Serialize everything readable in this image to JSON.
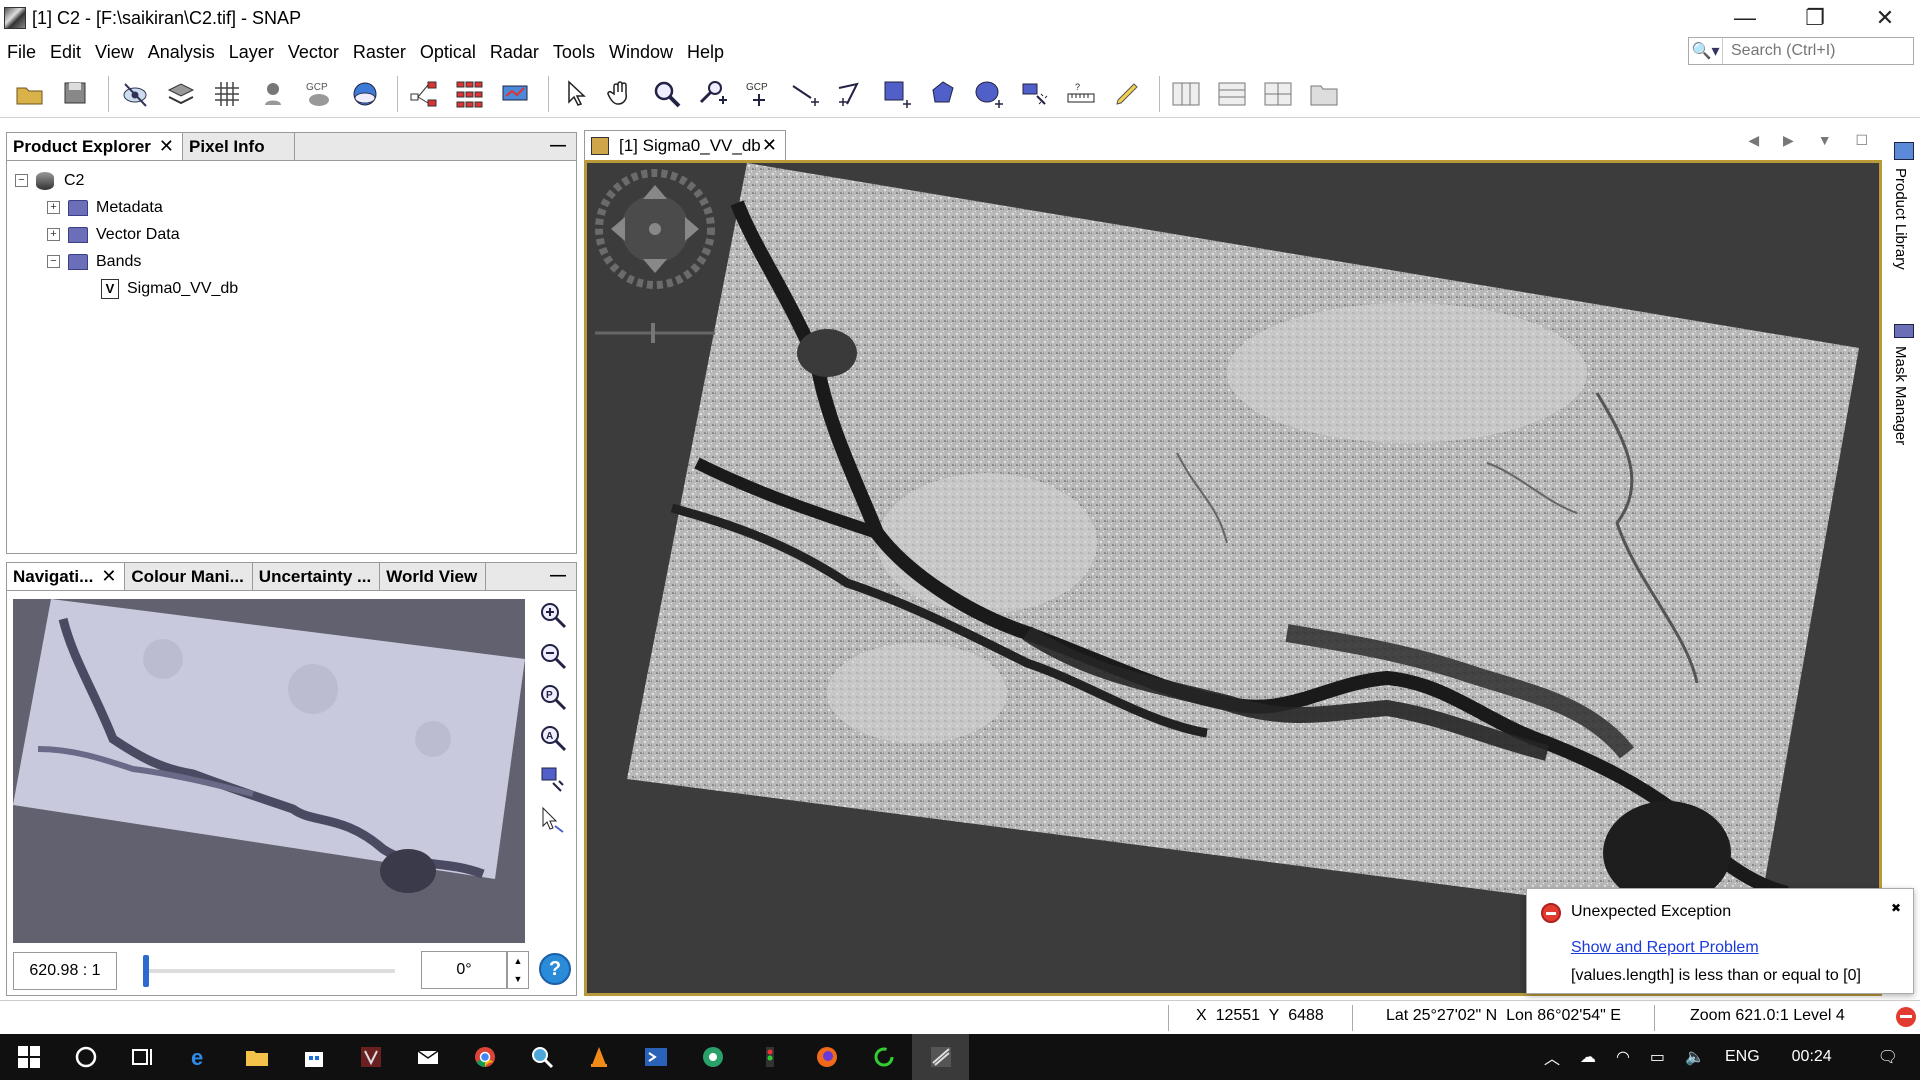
{
  "window": {
    "title": "[1] C2 - [F:\\saikiran\\C2.tif] - SNAP",
    "minimize": "—",
    "restore": "❐",
    "close": "✕"
  },
  "menu": [
    "File",
    "Edit",
    "View",
    "Analysis",
    "Layer",
    "Vector",
    "Raster",
    "Optical",
    "Radar",
    "Tools",
    "Window",
    "Help"
  ],
  "search": {
    "placeholder": "Search (Ctrl+I)"
  },
  "product_explorer": {
    "tabs": [
      {
        "label": "Product Explorer",
        "close": "✕"
      },
      {
        "label": "Pixel Info"
      }
    ],
    "minimize": "—",
    "tree": {
      "root": "C2",
      "expand_plus": "+",
      "expand_minus": "−",
      "children": [
        "Metadata",
        "Vector Data",
        "Bands"
      ],
      "band_icon": "V",
      "band": "Sigma0_VV_db"
    }
  },
  "navigation": {
    "tabs": [
      {
        "label": "Navigati...",
        "close": "✕"
      },
      {
        "label": "Colour Mani..."
      },
      {
        "label": "Uncertainty ..."
      },
      {
        "label": "World View"
      }
    ],
    "minimize": "—",
    "scale": "620.98 : 1",
    "rotation": "0°",
    "spin_up": "▲",
    "spin_down": "▼",
    "help": "?",
    "zoom_slider_value": 0.0
  },
  "image_view": {
    "tab_label": "[1] Sigma0_VV_db",
    "tab_close": "✕",
    "controls": "◀ ▶ ▼ ☐"
  },
  "right_sidebar": {
    "product_library": "Product Library",
    "mask_manager": "Mask Manager"
  },
  "notification": {
    "title": "Unexpected Exception",
    "link": "Show and Report Problem",
    "message": "[values.length] is less than or equal to [0]",
    "close": "✖"
  },
  "status": {
    "x_label": "X",
    "x": "12551",
    "y_label": "Y",
    "y": "6488",
    "lat_label": "Lat",
    "lat": "25°27'02\" N",
    "lon_label": "Lon",
    "lon": "86°02'54\" E",
    "zoom": "Zoom 621.0:1",
    "level": "Level 4"
  },
  "taskbar": {
    "language": "ENG",
    "time": "00:24"
  }
}
